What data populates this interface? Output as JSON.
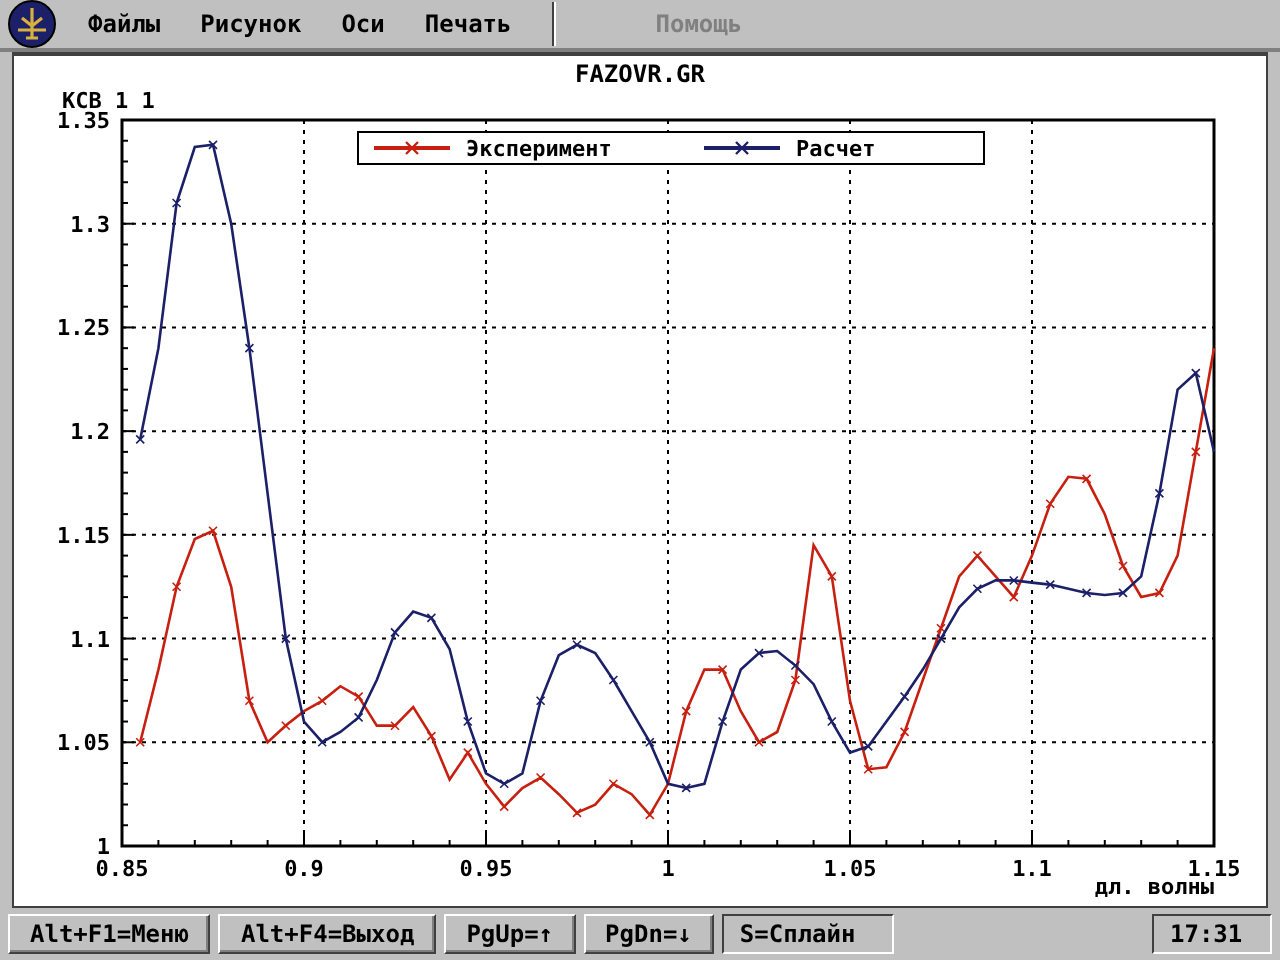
{
  "menu": {
    "items": [
      {
        "label": "Файлы",
        "disabled": false
      },
      {
        "label": "Рисунок",
        "disabled": false
      },
      {
        "label": "Оси",
        "disabled": false
      },
      {
        "label": "Печать",
        "disabled": false
      },
      {
        "label": "Помощь",
        "disabled": true
      }
    ]
  },
  "graph": {
    "title": "FAZOVR.GR",
    "chart_data": {
      "type": "line",
      "grid": true,
      "legend": true,
      "ylabel": "КСВ 1 1",
      "xlabel": "дл. волны",
      "xlim": [
        0.85,
        1.15
      ],
      "ylim": [
        1,
        1.35
      ],
      "xticks": [
        {
          "value": 0.85,
          "label": "0.85"
        },
        {
          "value": 0.9,
          "label": "0.9"
        },
        {
          "value": 0.95,
          "label": "0.95"
        },
        {
          "value": 1,
          "label": "1"
        },
        {
          "value": 1.05,
          "label": "1.05"
        },
        {
          "value": 1.1,
          "label": "1.1"
        },
        {
          "value": 1.15,
          "label": "1.15"
        }
      ],
      "yticks": [
        {
          "value": 1,
          "label": "1"
        },
        {
          "value": 1.05,
          "label": "1.05"
        },
        {
          "value": 1.1,
          "label": "1.1"
        },
        {
          "value": 1.15,
          "label": "1.15"
        },
        {
          "value": 1.2,
          "label": "1.2"
        },
        {
          "value": 1.25,
          "label": "1.25"
        },
        {
          "value": 1.3,
          "label": "1.3"
        },
        {
          "value": 1.35,
          "label": "1.35"
        }
      ],
      "x": [
        0.855,
        0.86,
        0.865,
        0.87,
        0.875,
        0.88,
        0.885,
        0.89,
        0.895,
        0.9,
        0.905,
        0.91,
        0.915,
        0.92,
        0.925,
        0.93,
        0.935,
        0.94,
        0.945,
        0.95,
        0.955,
        0.96,
        0.965,
        0.97,
        0.975,
        0.98,
        0.985,
        0.99,
        0.995,
        1.0,
        1.005,
        1.01,
        1.015,
        1.02,
        1.025,
        1.03,
        1.035,
        1.04,
        1.045,
        1.05,
        1.055,
        1.06,
        1.065,
        1.07,
        1.075,
        1.08,
        1.085,
        1.09,
        1.095,
        1.1,
        1.105,
        1.11,
        1.115,
        1.12,
        1.125,
        1.13,
        1.135,
        1.14,
        1.145,
        1.15
      ],
      "series": [
        {
          "name": "Эксперимент",
          "color": "#c82010",
          "values": [
            1.05,
            1.085,
            1.125,
            1.148,
            1.152,
            1.125,
            1.07,
            1.05,
            1.058,
            1.065,
            1.07,
            1.077,
            1.072,
            1.058,
            1.058,
            1.067,
            1.053,
            1.032,
            1.045,
            1.03,
            1.019,
            1.028,
            1.033,
            1.025,
            1.016,
            1.02,
            1.03,
            1.025,
            1.015,
            1.03,
            1.065,
            1.085,
            1.085,
            1.065,
            1.05,
            1.055,
            1.08,
            1.145,
            1.13,
            1.07,
            1.037,
            1.038,
            1.055,
            1.08,
            1.105,
            1.13,
            1.14,
            1.13,
            1.12,
            1.14,
            1.165,
            1.178,
            1.177,
            1.16,
            1.135,
            1.12,
            1.122,
            1.14,
            1.19,
            1.24
          ]
        },
        {
          "name": "Расчет",
          "color": "#1c2068",
          "values": [
            1.196,
            1.24,
            1.31,
            1.337,
            1.338,
            1.3,
            1.24,
            1.17,
            1.1,
            1.06,
            1.05,
            1.055,
            1.062,
            1.08,
            1.103,
            1.113,
            1.11,
            1.095,
            1.06,
            1.035,
            1.03,
            1.035,
            1.07,
            1.092,
            1.097,
            1.093,
            1.08,
            1.065,
            1.05,
            1.03,
            1.028,
            1.03,
            1.06,
            1.085,
            1.093,
            1.094,
            1.087,
            1.078,
            1.06,
            1.045,
            1.048,
            1.06,
            1.072,
            1.085,
            1.1,
            1.115,
            1.124,
            1.128,
            1.128,
            1.127,
            1.126,
            1.124,
            1.122,
            1.121,
            1.122,
            1.13,
            1.17,
            1.22,
            1.228,
            1.19
          ]
        }
      ]
    }
  },
  "footer": {
    "keys": [
      "Alt+F1=Меню",
      "Alt+F4=Выход",
      "PgUp=↑",
      "PgDn=↓"
    ],
    "mode": "S=Сплайн",
    "clock": "17:31"
  }
}
